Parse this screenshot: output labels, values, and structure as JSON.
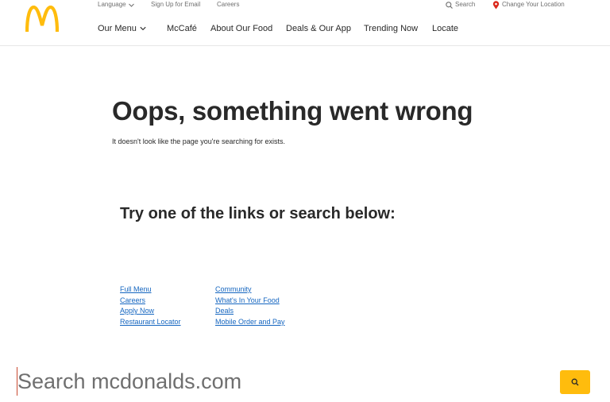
{
  "colors": {
    "brand_yellow": "#ffbc0d",
    "link": "#1566c0",
    "pin_red": "#da291c",
    "text": "#292929"
  },
  "header": {
    "logo_icon": "golden-arches-logo",
    "utility": {
      "language": "Language",
      "signup": "Sign Up for Email",
      "careers": "Careers",
      "search": "Search",
      "location": "Change Your Location"
    },
    "nav": {
      "menu": "Our Menu",
      "mccafe": "McCafé",
      "about": "About Our Food",
      "deals": "Deals & Our App",
      "trending": "Trending Now",
      "locate": "Locate"
    }
  },
  "main": {
    "title": "Oops, something went wrong",
    "subtitle": "It doesn't look like the page you're searching for exists.",
    "links_heading": "Try one of the links or search below:",
    "links_left": [
      "Full Menu",
      "Careers",
      "Apply Now",
      "Restaurant Locator"
    ],
    "links_right": [
      "Community",
      "What's In Your Food",
      "Deals",
      "Mobile Order and Pay"
    ]
  },
  "search": {
    "placeholder": "Search mcdonalds.com",
    "button_icon": "search-icon"
  }
}
